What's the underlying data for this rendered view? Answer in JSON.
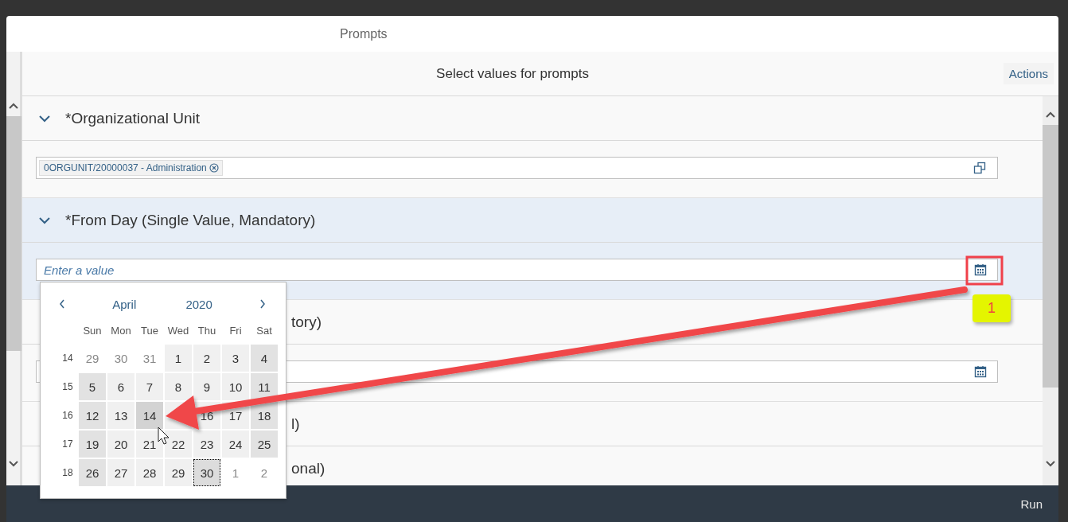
{
  "dialog": {
    "title": "Prompts",
    "subtitle": "Select values for prompts",
    "actions": "Actions"
  },
  "prompts": [
    {
      "kind": "tokens",
      "title": "*Organizational Unit",
      "selected": false,
      "tokens": [
        "0ORGUNIT/20000037 - Administration"
      ]
    },
    {
      "kind": "date",
      "title": "*From Day (Single Value, Mandatory)",
      "selected": true,
      "placeholder": "Enter a value"
    },
    {
      "kind": "date",
      "title": "tory)",
      "selected": false
    },
    {
      "kind": "header",
      "title": "l)",
      "selected": false
    },
    {
      "kind": "header",
      "title": "onal)",
      "selected": false
    }
  ],
  "calendar": {
    "month": "April",
    "year": "2020",
    "weekdays": [
      "Sun",
      "Mon",
      "Tue",
      "Wed",
      "Thu",
      "Fri",
      "Sat"
    ],
    "weeks": [
      {
        "number": "14",
        "days": [
          {
            "label": "29",
            "kind": "other"
          },
          {
            "label": "30",
            "kind": "other"
          },
          {
            "label": "31",
            "kind": "other"
          },
          {
            "label": "1",
            "kind": "weekday"
          },
          {
            "label": "2",
            "kind": "weekday"
          },
          {
            "label": "3",
            "kind": "weekday"
          },
          {
            "label": "4",
            "kind": "weekend"
          }
        ]
      },
      {
        "number": "15",
        "days": [
          {
            "label": "5",
            "kind": "weekend"
          },
          {
            "label": "6",
            "kind": "weekday"
          },
          {
            "label": "7",
            "kind": "weekday"
          },
          {
            "label": "8",
            "kind": "weekday"
          },
          {
            "label": "9",
            "kind": "weekday"
          },
          {
            "label": "10",
            "kind": "weekday"
          },
          {
            "label": "11",
            "kind": "weekend"
          }
        ]
      },
      {
        "number": "16",
        "days": [
          {
            "label": "12",
            "kind": "weekend"
          },
          {
            "label": "13",
            "kind": "weekday"
          },
          {
            "label": "14",
            "kind": "hover"
          },
          {
            "kind": "weekday"
          },
          {
            "label": "16",
            "kind": "weekday"
          },
          {
            "label": "17",
            "kind": "weekday"
          },
          {
            "label": "18",
            "kind": "weekend"
          }
        ]
      },
      {
        "number": "17",
        "days": [
          {
            "label": "19",
            "kind": "weekend"
          },
          {
            "label": "20",
            "kind": "weekday"
          },
          {
            "label": "21",
            "kind": "weekday"
          },
          {
            "label": "22",
            "kind": "weekday"
          },
          {
            "label": "23",
            "kind": "weekday"
          },
          {
            "label": "24",
            "kind": "weekday"
          },
          {
            "label": "25",
            "kind": "weekend"
          }
        ]
      },
      {
        "number": "18",
        "days": [
          {
            "label": "26",
            "kind": "weekend"
          },
          {
            "label": "27",
            "kind": "weekday"
          },
          {
            "label": "28",
            "kind": "weekday"
          },
          {
            "label": "29",
            "kind": "weekday"
          },
          {
            "label": "30",
            "kind": "today"
          },
          {
            "label": "1",
            "kind": "other"
          },
          {
            "label": "2",
            "kind": "other"
          }
        ]
      }
    ]
  },
  "annotation": {
    "badge": "1"
  },
  "footer": {
    "run": "Run"
  }
}
